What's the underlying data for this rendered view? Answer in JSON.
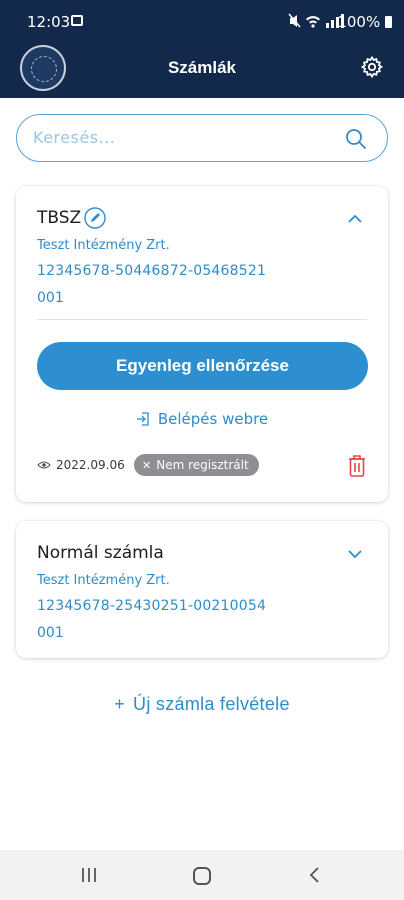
{
  "status_bar": {
    "time": "12:03",
    "system_icons": "🔇 📶 ▮▮",
    "battery": "100%"
  },
  "app_bar": {
    "title": "Számlák"
  },
  "search": {
    "placeholder": "Keresés..."
  },
  "accounts": [
    {
      "name": "TBSZ",
      "institution": "Teszt Intézmény Zrt.",
      "account_number": "12345678-50446872-05468521",
      "sub_account": "001",
      "expanded": true,
      "balance_button": "Egyenleg ellenőrzése",
      "web_login": "Belépés webre",
      "date": "2022.09.06",
      "status_badge": "Nem regisztrált"
    },
    {
      "name": "Normál számla",
      "institution": "Teszt Intézmény Zrt.",
      "account_number": "12345678-25430251-00210054",
      "sub_account": "001",
      "expanded": false
    }
  ],
  "add_account": {
    "label": "Új számla felvétele"
  },
  "colors": {
    "header_bg": "#13294b",
    "accent": "#2e8fd0",
    "link": "#2e8cc9",
    "delete": "#e04848",
    "badge_bg": "#8d8f92"
  }
}
